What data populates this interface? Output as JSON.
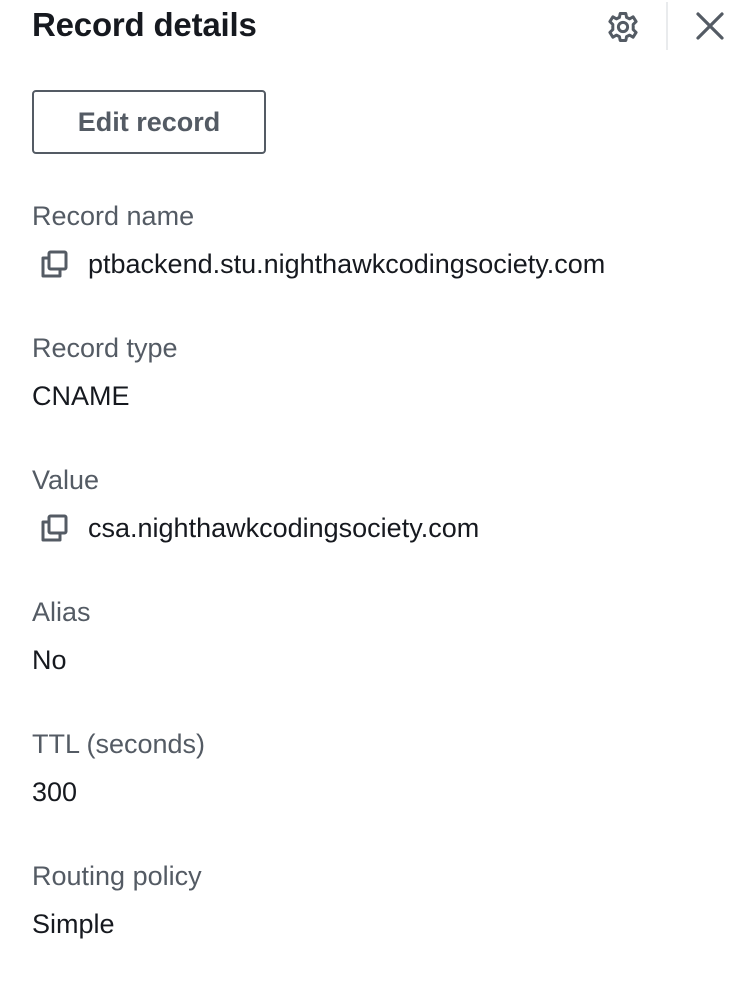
{
  "header": {
    "title": "Record details",
    "settings_icon": "gear-icon",
    "close_icon": "close-icon"
  },
  "actions": {
    "edit_label": "Edit record"
  },
  "fields": [
    {
      "label": "Record name",
      "value": "ptbackend.stu.nighthawkcodingsociety.com",
      "copy_icon": "copy-icon"
    },
    {
      "label": "Record type",
      "value": "CNAME"
    },
    {
      "label": "Value",
      "value": "csa.nighthawkcodingsociety.com",
      "copy_icon": "copy-icon"
    },
    {
      "label": "Alias",
      "value": "No"
    },
    {
      "label": "TTL (seconds)",
      "value": "300"
    },
    {
      "label": "Routing policy",
      "value": "Simple"
    }
  ],
  "colors": {
    "label": "#545b64",
    "value": "#16191f",
    "button_border": "#545b64",
    "divider": "#e9ebed"
  }
}
